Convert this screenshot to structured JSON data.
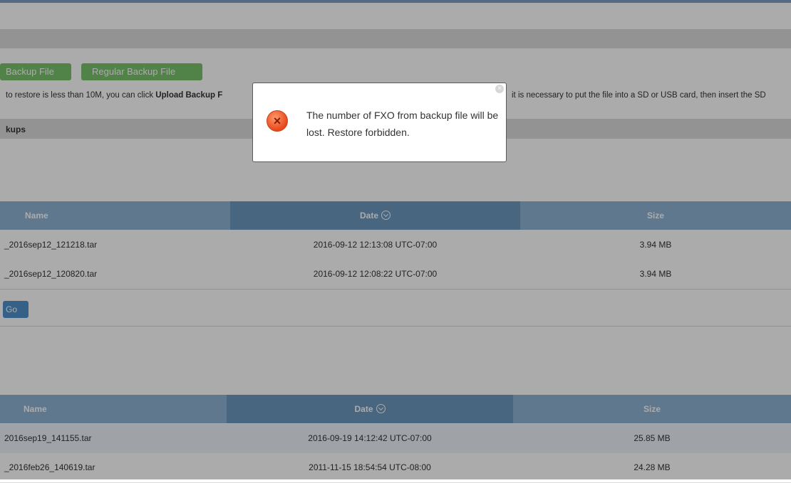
{
  "buttons": {
    "upload_backup": "Backup File",
    "regular_backup": "Regular Backup File"
  },
  "help": {
    "prefix": "to restore is less than 10M, you can click ",
    "bold": "Upload Backup F",
    "suffix": "it is necessary to put the file into a SD or USB card, then insert the SD"
  },
  "section_title": "kups",
  "table1": {
    "headers": [
      "Name",
      "Date",
      "Size"
    ],
    "rows": [
      {
        "name": "_2016sep12_121218.tar",
        "date": "2016-09-12 12:13:08 UTC-07:00",
        "size": "3.94 MB"
      },
      {
        "name": "_2016sep12_120820.tar",
        "date": "2016-09-12 12:08:22 UTC-07:00",
        "size": "3.94 MB"
      }
    ]
  },
  "go_button": "Go",
  "table2": {
    "headers": [
      "Name",
      "Date",
      "Size"
    ],
    "rows": [
      {
        "name": "2016sep19_141155.tar",
        "date": "2016-09-19 14:12:42 UTC-07:00",
        "size": "25.85 MB"
      },
      {
        "name": "_2016feb26_140619.tar",
        "date": "2011-11-15 18:54:54 UTC-08:00",
        "size": "24.28 MB"
      }
    ]
  },
  "dialog": {
    "icon": "error-icon",
    "message": "The number of FXO from backup file will be lost. Restore forbidden."
  }
}
